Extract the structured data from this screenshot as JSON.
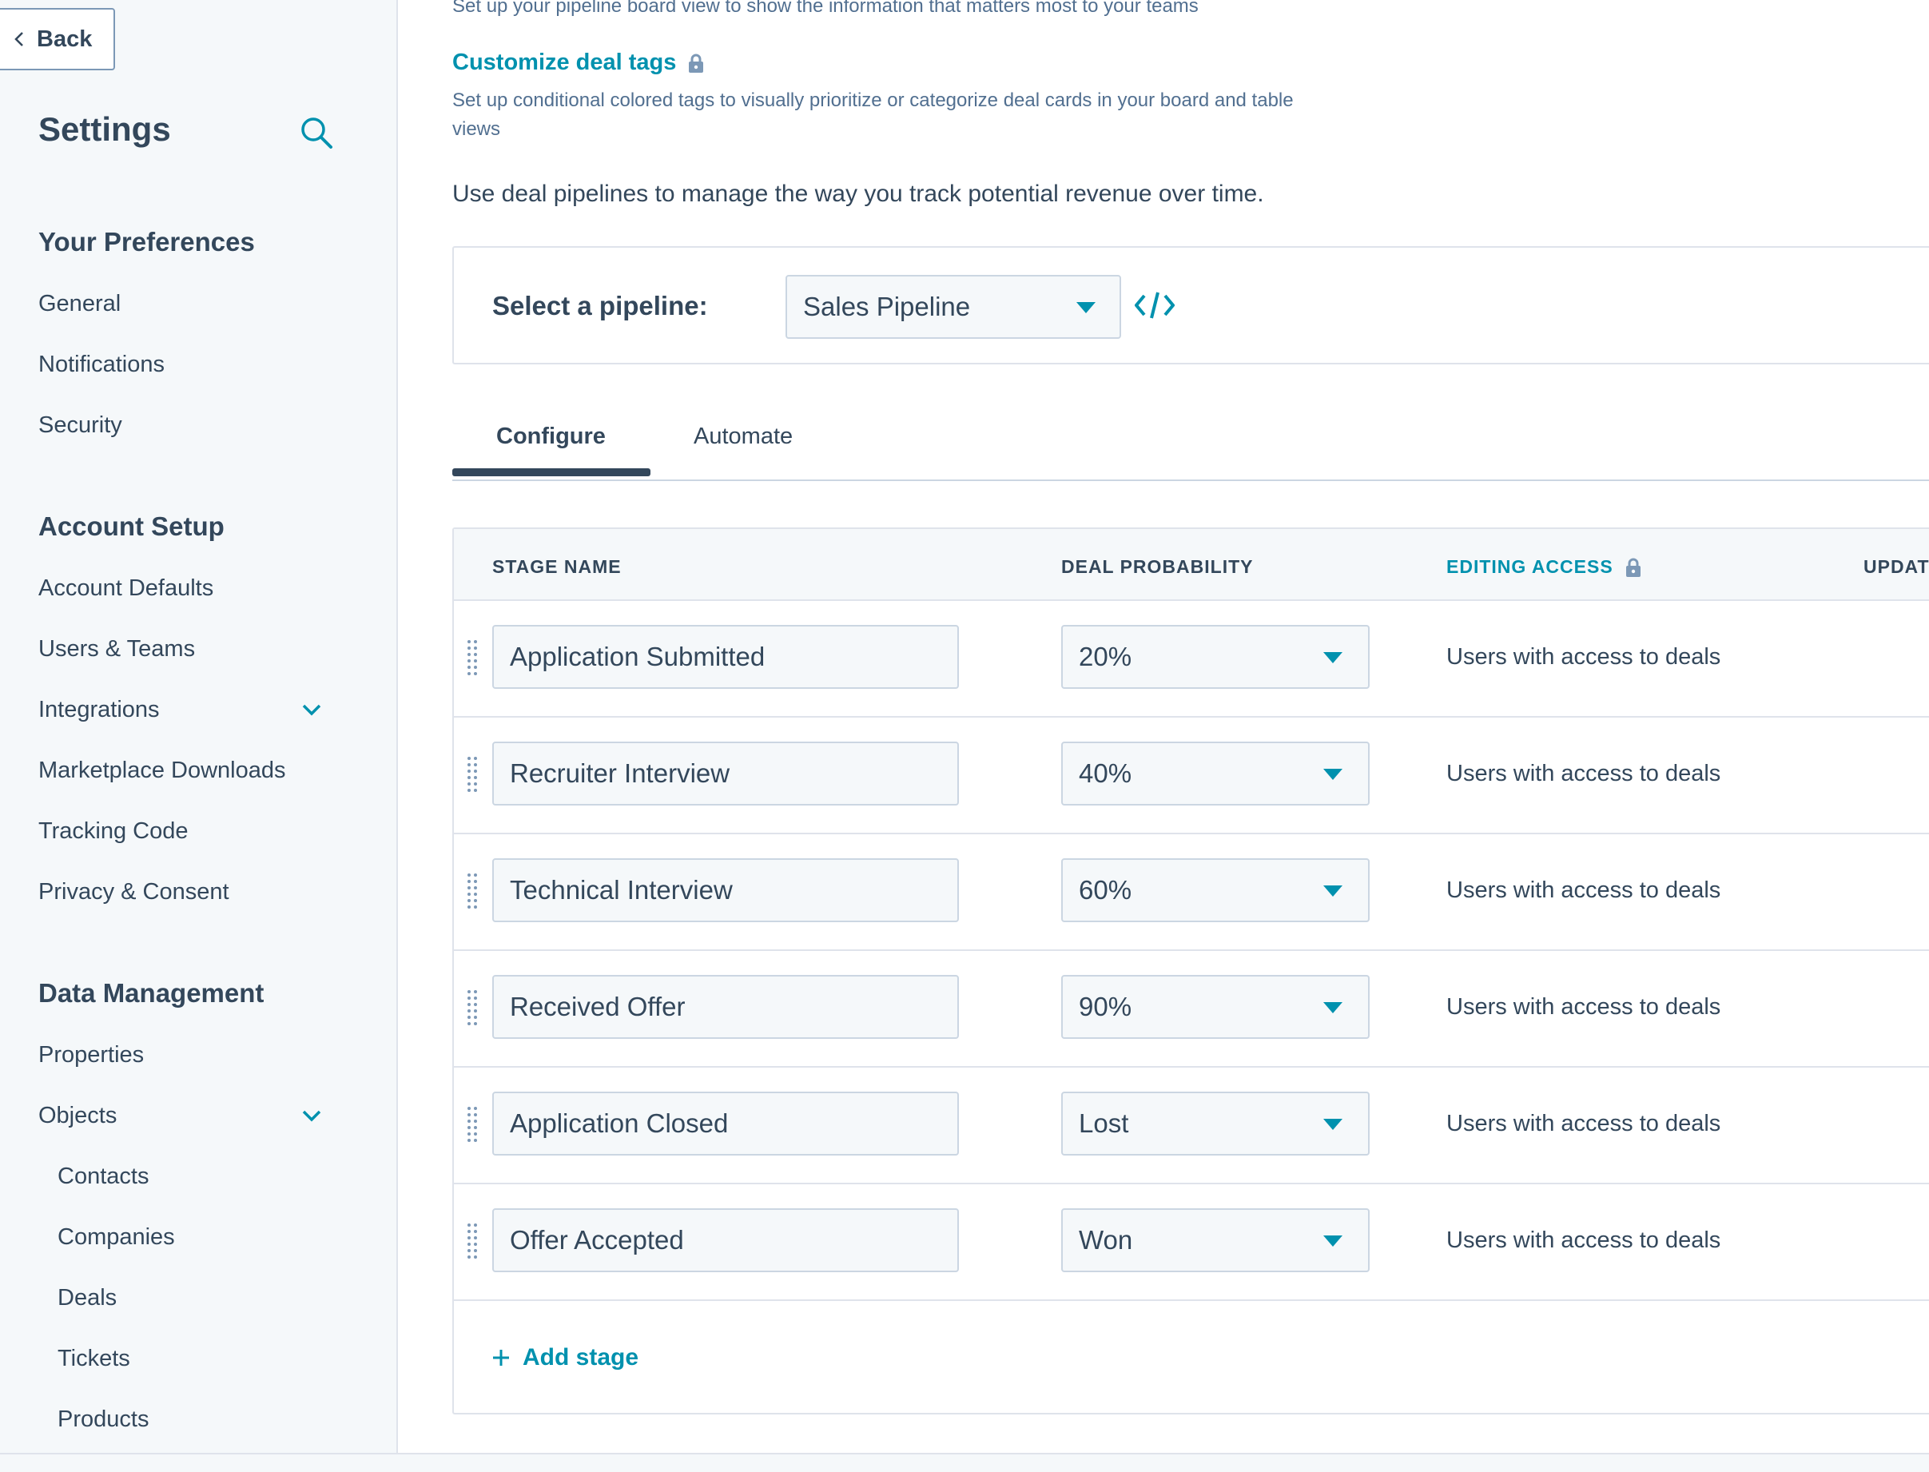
{
  "sidebar": {
    "back_label": "Back",
    "title": "Settings",
    "sections": {
      "preferences": {
        "heading": "Your Preferences",
        "items": [
          "General",
          "Notifications",
          "Security"
        ]
      },
      "account": {
        "heading": "Account Setup",
        "items": [
          "Account Defaults",
          "Users & Teams",
          "Integrations",
          "Marketplace Downloads",
          "Tracking Code",
          "Privacy & Consent"
        ]
      },
      "data": {
        "heading": "Data Management",
        "items": [
          "Properties",
          "Objects"
        ],
        "object_subitems": [
          "Contacts",
          "Companies",
          "Deals",
          "Tickets",
          "Products"
        ]
      }
    }
  },
  "main": {
    "board_view_desc": "Set up your pipeline board view to show the information that matters most to your teams",
    "customize_tags_link": "Customize deal tags",
    "customize_tags_desc": "Set up conditional colored tags to visually prioritize or categorize deal cards in your board and table views",
    "intro_text": "Use deal pipelines to manage the way you track potential revenue over time.",
    "pipeline": {
      "label": "Select a pipeline:",
      "selected": "Sales Pipeline"
    },
    "tabs": [
      {
        "label": "Configure",
        "active": true
      },
      {
        "label": "Automate",
        "active": false
      }
    ],
    "table": {
      "headers": {
        "stage_name": "STAGE NAME",
        "deal_probability": "DEAL PROBABILITY",
        "editing_access": "EDITING ACCESS",
        "updated": "UPDAT"
      },
      "rows": [
        {
          "stage": "Application Submitted",
          "probability": "20%",
          "access": "Users with access to deals"
        },
        {
          "stage": "Recruiter Interview",
          "probability": "40%",
          "access": "Users with access to deals"
        },
        {
          "stage": "Technical Interview",
          "probability": "60%",
          "access": "Users with access to deals"
        },
        {
          "stage": "Received Offer",
          "probability": "90%",
          "access": "Users with access to deals"
        },
        {
          "stage": "Application Closed",
          "probability": "Lost",
          "access": "Users with access to deals"
        },
        {
          "stage": "Offer Accepted",
          "probability": "Won",
          "access": "Users with access to deals"
        }
      ],
      "add_stage_label": "Add stage"
    }
  },
  "colors": {
    "text": "#33475b",
    "link": "#0091ae",
    "border": "#cbd6e2",
    "sidebar_bg": "#f5f8fa"
  },
  "icons": [
    "chevron-left-icon",
    "search-icon",
    "chevron-down-icon",
    "lock-icon",
    "caret-down-icon",
    "code-embed-icon",
    "drag-handle-icon",
    "plus-icon"
  ]
}
